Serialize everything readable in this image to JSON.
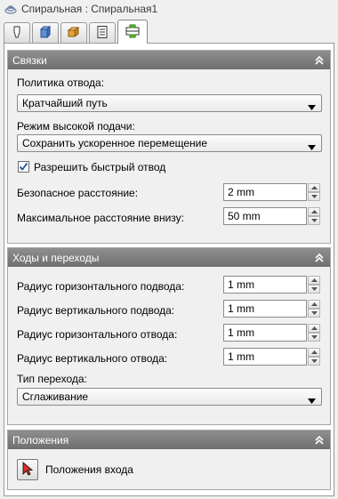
{
  "title": "Спиральная : Спиральная1",
  "tabs": [
    {
      "icon": "tool-icon"
    },
    {
      "icon": "stock-icon"
    },
    {
      "icon": "block-icon"
    },
    {
      "icon": "list-icon"
    },
    {
      "icon": "links-icon",
      "active": true
    }
  ],
  "links": {
    "header": "Связки",
    "retract_policy_label": "Политика отвода:",
    "retract_policy_value": "Кратчайший путь",
    "high_feed_label": "Режим высокой подачи:",
    "high_feed_value": "Сохранить ускоренное перемещение",
    "fast_retract_label": "Разрешить быстрый отвод",
    "fast_retract_checked": true,
    "safe_distance_label": "Безопасное расстояние:",
    "safe_distance_value": "2 mm",
    "max_down_label": "Максимальное расстояние внизу:",
    "max_down_value": "50 mm"
  },
  "passes": {
    "header": "Ходы и переходы",
    "h_lead_in_label": "Радиус горизонтального подвода:",
    "h_lead_in_value": "1 mm",
    "v_lead_in_label": "Радиус вертикального подвода:",
    "v_lead_in_value": "1 mm",
    "h_lead_out_label": "Радиус горизонтального отвода:",
    "h_lead_out_value": "1 mm",
    "v_lead_out_label": "Радиус вертикального отвода:",
    "v_lead_out_value": "1 mm",
    "transition_type_label": "Тип перехода:",
    "transition_type_value": "Сглаживание"
  },
  "positions": {
    "header": "Положения",
    "entry_label": "Положения входа"
  }
}
